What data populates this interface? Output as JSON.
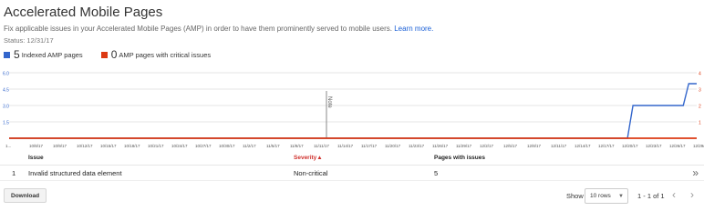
{
  "header": {
    "title": "Accelerated Mobile Pages",
    "description": "Fix applicable issues in your Accelerated Mobile Pages (AMP) in order to have them prominently served to mobile users.",
    "learn_more": "Learn more.",
    "status": "Status: 12/31/17"
  },
  "legend": {
    "indexed": {
      "count": "5",
      "label": "Indexed AMP pages",
      "color": "#3366cc"
    },
    "critical": {
      "count": "0",
      "label": "AMP pages with critical issues",
      "color": "#dc3912"
    }
  },
  "chart_data": {
    "type": "line",
    "left_axis_ticks": [
      "6.0",
      "4.5",
      "3.0",
      "1.5"
    ],
    "right_axis_ticks": [
      "4",
      "3",
      "2",
      "1"
    ],
    "x_tick_labels": [
      "1...",
      "10/8/17",
      "10/9/17",
      "10/12/17",
      "10/15/17",
      "10/18/17",
      "10/21/17",
      "10/24/17",
      "10/27/17",
      "10/30/17",
      "11/2/17",
      "11/5/17",
      "11/8/17",
      "11/11/17",
      "11/14/17",
      "11/17/17",
      "11/20/17",
      "11/23/17",
      "11/26/17",
      "11/29/17",
      "12/2/17",
      "12/5/17",
      "12/8/17",
      "12/11/17",
      "12/14/17",
      "12/17/17",
      "12/20/17",
      "12/23/17",
      "12/26/17",
      "12/29/17"
    ],
    "annotation": "Note",
    "ylim_left": [
      0,
      6
    ],
    "ylim_right": [
      0,
      4
    ],
    "series": [
      {
        "name": "Indexed AMP pages",
        "color": "#3366cc",
        "axis": "left",
        "x": [
          "12/20/17",
          "12/21/17",
          "12/22/17",
          "12/23/17",
          "12/24/17",
          "12/25/17",
          "12/26/17",
          "12/27/17",
          "12/28/17",
          "12/29/17",
          "12/30/17",
          "12/31/17"
        ],
        "values": [
          0,
          0,
          0,
          3,
          3,
          3,
          3,
          3,
          3,
          3,
          5,
          5
        ]
      },
      {
        "name": "AMP pages with critical issues",
        "color": "#dc3912",
        "axis": "right",
        "x": [
          "10/8/17",
          "12/31/17"
        ],
        "values": [
          0,
          0
        ]
      }
    ]
  },
  "table": {
    "headers": {
      "issue": "Issue",
      "severity": "Severity",
      "severity_arrow": "▲",
      "pages": "Pages with issues"
    },
    "rows": [
      {
        "index": "1",
        "issue": "Invalid structured data element",
        "severity": "Non-critical",
        "pages": "5"
      }
    ]
  },
  "footer": {
    "download_label": "Download",
    "show_label": "Show",
    "rows_select": "10 rows",
    "page_info": "1 - 1 of 1"
  }
}
